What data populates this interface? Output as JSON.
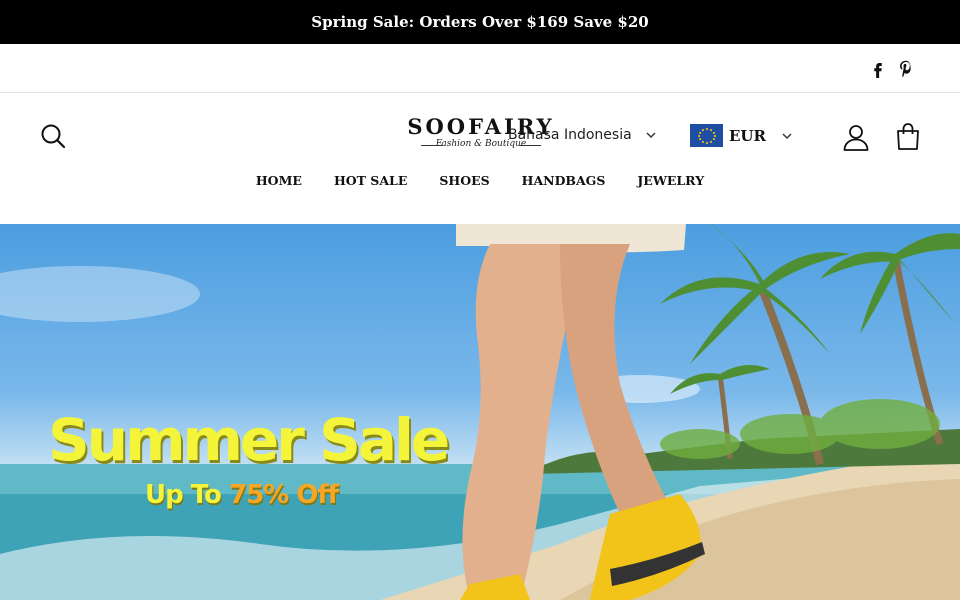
{
  "announcement": "Spring Sale: Orders Over $169 Save $20",
  "social": {
    "icons": [
      "facebook-icon",
      "pinterest-icon"
    ]
  },
  "header": {
    "logo": {
      "name": "SOOFAIRY",
      "tagline": "Fashion & Boutique"
    },
    "language": "Bahasa Indonesia",
    "currency": "EUR",
    "icons": [
      "search-icon",
      "account-icon",
      "cart-icon"
    ]
  },
  "nav": {
    "items": [
      "HOME",
      "HOT SALE",
      "SHOES",
      "HANDBAGS",
      "JEWELRY"
    ]
  },
  "hero": {
    "title": "Summer Sale",
    "subtitle_prefix": "Up To ",
    "subtitle_highlight": "75% Off"
  },
  "colors": {
    "announce_bg": "#000000",
    "hero_text": "#f4f53a",
    "hero_highlight": "#f6a623",
    "eu_flag": "#1f4fa3"
  }
}
